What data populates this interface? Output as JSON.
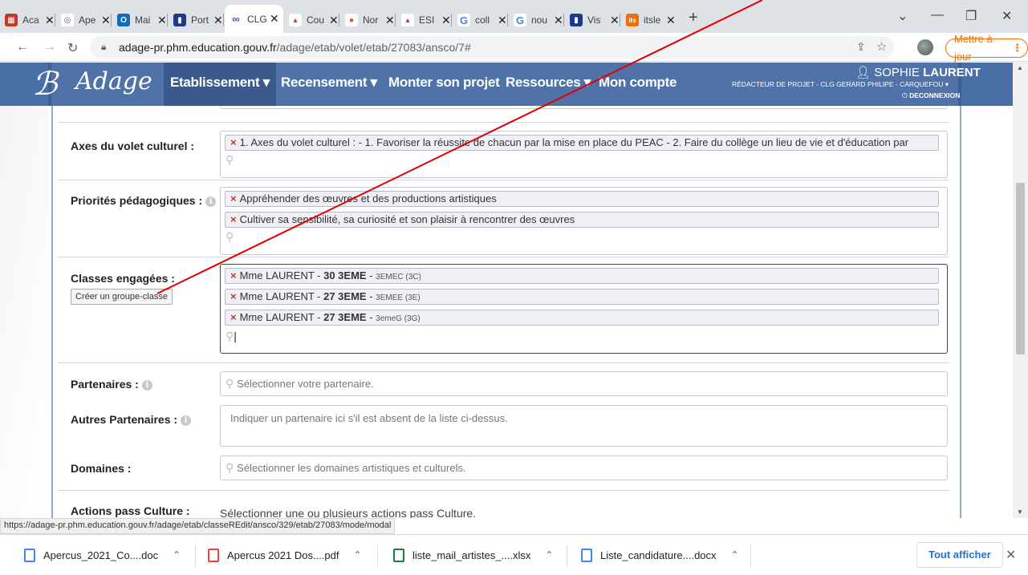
{
  "browser": {
    "tabs": [
      {
        "title": "Aca",
        "color": "#c0392b",
        "glyph": "▦"
      },
      {
        "title": "Ape",
        "color": "#5f6368",
        "glyph": "◎"
      },
      {
        "title": "Mai",
        "color": "#0f6cbd",
        "glyph": "O"
      },
      {
        "title": "Port",
        "color": "#1b3a8a",
        "glyph": "▮"
      },
      {
        "title": "CLG",
        "color": "#6b3fa0",
        "glyph": "∞"
      },
      {
        "title": "Cou",
        "color": "#c0392b",
        "glyph": "▴"
      },
      {
        "title": "Nor",
        "color": "#ea4335",
        "glyph": "●"
      },
      {
        "title": "ESI",
        "color": "#c0392b",
        "glyph": "▴"
      },
      {
        "title": "coll",
        "color": "#4285f4",
        "glyph": "G"
      },
      {
        "title": "nou",
        "color": "#4285f4",
        "glyph": "G"
      },
      {
        "title": "Vis",
        "color": "#1b3a8a",
        "glyph": "▮"
      },
      {
        "title": "itsle",
        "color": "#e8710a",
        "glyph": "its"
      }
    ],
    "url_host": "adage-pr.phm.education.gouv.fr",
    "url_path": "/adage/etab/volet/etab/27083/ansco/7#",
    "update_label": "Mettre à jour",
    "status_url": "https://adage-pr.phm.education.gouv.fr/adage/etab/classeREdit/ansco/329/etab/27083/mode/modal"
  },
  "app": {
    "logo": "Adage",
    "menu": [
      "Etablissement ▾",
      "Recensement ▾",
      "Monter son projet",
      "Ressources ▾",
      "Mon compte"
    ],
    "user_first": "SOPHIE",
    "user_last": "LAURENT",
    "user_role": "RÉDACTEUR DE PROJET - CLG GERARD PHILIPE - CARQUEFOU",
    "logout": "DECONNEXION"
  },
  "form": {
    "axes_label": "Axes du volet culturel :",
    "axes_chip": "1. Axes du volet culturel : - 1. Favoriser la réussite de chacun par la mise en place du PEAC - 2. Faire du collège un lieu de vie et d'éducation par",
    "prio_label": "Priorités pédagogiques :",
    "prio_chips": [
      "Appréhender des œuvres et des productions artistiques",
      "Cultiver sa sensibilité, sa curiosité et son plaisir à rencontrer des œuvres"
    ],
    "classes_label": "Classes engagées :",
    "create_group": "Créer un groupe-classe",
    "classes": [
      {
        "teacher": "Mme LAURENT - ",
        "count": "30 3EME",
        "sep": " - ",
        "code": "3EMEC (3C)"
      },
      {
        "teacher": "Mme LAURENT - ",
        "count": "27 3EME",
        "sep": " - ",
        "code": "3EMEE (3E)"
      },
      {
        "teacher": "Mme LAURENT - ",
        "count": "27 3EME",
        "sep": " - ",
        "code": "3emeG (3G)"
      }
    ],
    "partners_label": "Partenaires :",
    "partners_placeholder": "Sélectionner votre partenaire.",
    "other_partners_label": "Autres Partenaires :",
    "other_partners_placeholder": "Indiquer un partenaire ici s'il est absent de la liste ci-dessus.",
    "domains_label": "Domaines :",
    "domains_placeholder": "Sélectionner les domaines artistiques et culturels.",
    "actions_label": "Actions pass Culture :",
    "actions_text": "Sélectionner une ou plusieurs actions pass Culture."
  },
  "downloads": {
    "items": [
      {
        "name": "Apercus_2021_Co....doc",
        "color": "#4285f4"
      },
      {
        "name": "Apercus 2021 Dos....pdf",
        "color": "#ea4335"
      },
      {
        "name": "liste_mail_artistes_....xlsx",
        "color": "#188038"
      },
      {
        "name": "Liste_candidature....docx",
        "color": "#4285f4"
      }
    ],
    "show_all": "Tout afficher"
  }
}
